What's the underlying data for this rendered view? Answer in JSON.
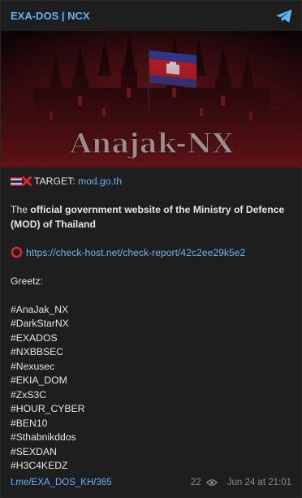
{
  "channel": {
    "title": "EXA-DOS | NCX"
  },
  "banner": {
    "title": "Anajak-NX"
  },
  "post": {
    "target_label": "TARGET:",
    "target_link": "mod.go.th",
    "desc_prefix": "The ",
    "desc_bold": "official government website of the Ministry of Defence (MOD) of Thailand",
    "report_link": "https://check-host.net/check-report/42c2ee29k5e2",
    "greetz": "Greetz:",
    "tags": [
      "#AnaJak_NX",
      "#DarkStarNX",
      "#EXADOS",
      "#NXBBSEC",
      "#Nexusec",
      "#EKIA_DOM",
      "#ZxS3C",
      "#HOUR_CYBER",
      "#BEN10",
      "#Sthabnikddos",
      "#SEXDAN",
      "#H3C4KEDZ"
    ]
  },
  "footer": {
    "source": "t.me/EXA_DOS_KH/365",
    "views": "22",
    "date": "Jun 24 at 21:01"
  },
  "icons": {
    "share": "telegram-plane-icon",
    "flag": "thailand-flag-icon",
    "cross": "red-cross-icon",
    "circle": "red-circle-icon",
    "eye": "eye-icon"
  },
  "colors": {
    "link": "#6ab2f2",
    "channel": "#5eb5f7",
    "background": "#1e1e1e",
    "text": "#e6e6e6"
  }
}
